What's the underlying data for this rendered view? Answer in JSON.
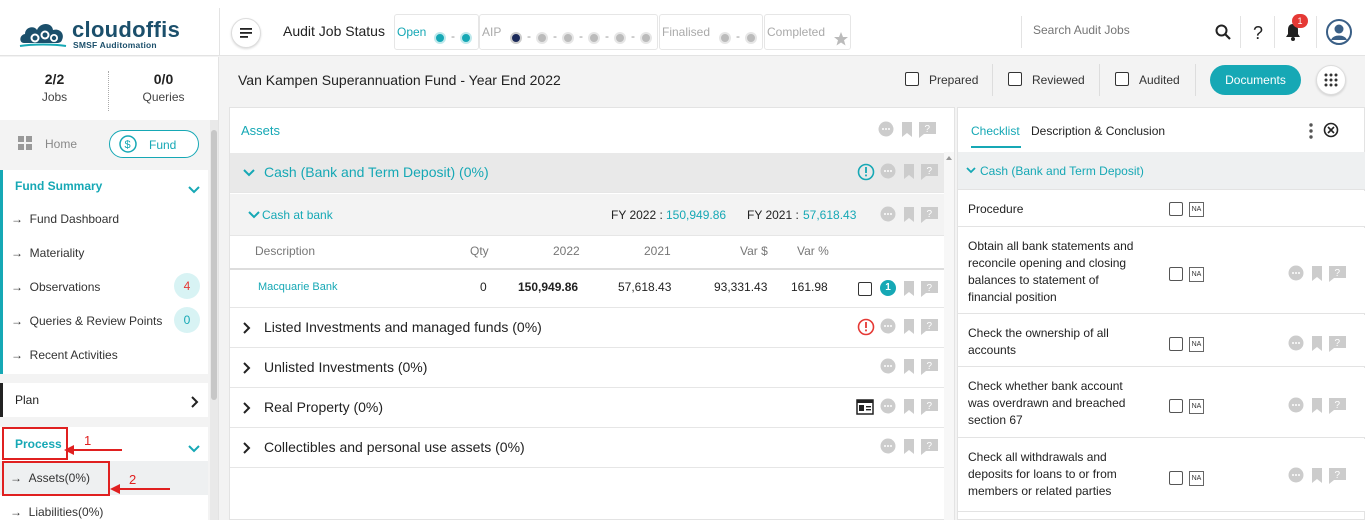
{
  "brand": {
    "name": "cloudoffis",
    "tagline": "SMSF Auditomation"
  },
  "header": {
    "title": "Audit Job Status",
    "status": {
      "open": "Open",
      "aip": "AIP",
      "finalised": "Finalised",
      "completed": "Completed"
    },
    "search_placeholder": "Search Audit Jobs",
    "notifications_count": "1"
  },
  "stats": {
    "jobs_value": "2/2",
    "jobs_label": "Jobs",
    "queries_value": "0/0",
    "queries_label": "Queries"
  },
  "nav": {
    "home": "Home",
    "fund": "Fund",
    "fund_summary": {
      "title": "Fund Summary",
      "items": [
        {
          "label": "Fund Dashboard"
        },
        {
          "label": "Materiality"
        },
        {
          "label": "Observations",
          "badge": "4"
        },
        {
          "label": "Queries & Review Points",
          "badge": "0"
        },
        {
          "label": "Recent Activities"
        }
      ]
    },
    "plan": "Plan",
    "process": {
      "title": "Process",
      "items": [
        {
          "label": "Assets(0%)"
        },
        {
          "label": "Liabilities(0%)"
        }
      ]
    },
    "annotations": [
      "1",
      "2"
    ]
  },
  "fund": {
    "title": "Van Kampen Superannuation Fund - Year End 2022",
    "prepared": "Prepared",
    "reviewed": "Reviewed",
    "audited": "Audited",
    "documents_button": "Documents"
  },
  "assets": {
    "title": "Assets",
    "expanded_category": "Cash (Bank and Term Deposit) (0%)",
    "subgroup": {
      "label": "Cash at bank",
      "fy2022_label": "FY 2022 :",
      "fy2022_value": "150,949.86",
      "fy2021_label": "FY 2021 :",
      "fy2021_value": "57,618.43"
    },
    "columns": [
      "Description",
      "Qty",
      "2022",
      "2021",
      "Var $",
      "Var %"
    ],
    "rows": [
      {
        "description": "Macquarie Bank",
        "qty": "0",
        "y2022": "150,949.86",
        "y2021": "57,618.43",
        "var_dollar": "93,331.43",
        "var_pct": "161.98",
        "comment_count": "1"
      }
    ],
    "other_categories": [
      {
        "label": "Listed Investments and managed funds (0%)"
      },
      {
        "label": "Unlisted Investments (0%)"
      },
      {
        "label": "Real Property (0%)"
      },
      {
        "label": "Collectibles and personal use assets (0%)"
      }
    ]
  },
  "checklist": {
    "tab_checklist": "Checklist",
    "tab_description": "Description & Conclusion",
    "section": "Cash (Bank and Term Deposit)",
    "procedure_header": "Procedure",
    "na_label": "NA",
    "items": [
      {
        "text": "Obtain all bank statements and reconcile opening and closing balances to statement of financial position"
      },
      {
        "text": "Check the ownership of all accounts"
      },
      {
        "text": "Check whether bank account was overdrawn and breached section 67"
      },
      {
        "text": "Check all withdrawals and deposits for loans to or from members or related parties"
      }
    ]
  },
  "colors": {
    "accent": "#16a8b5",
    "navy": "#1b4f6b",
    "alert": "#e53935",
    "annotation": "#e02020"
  }
}
